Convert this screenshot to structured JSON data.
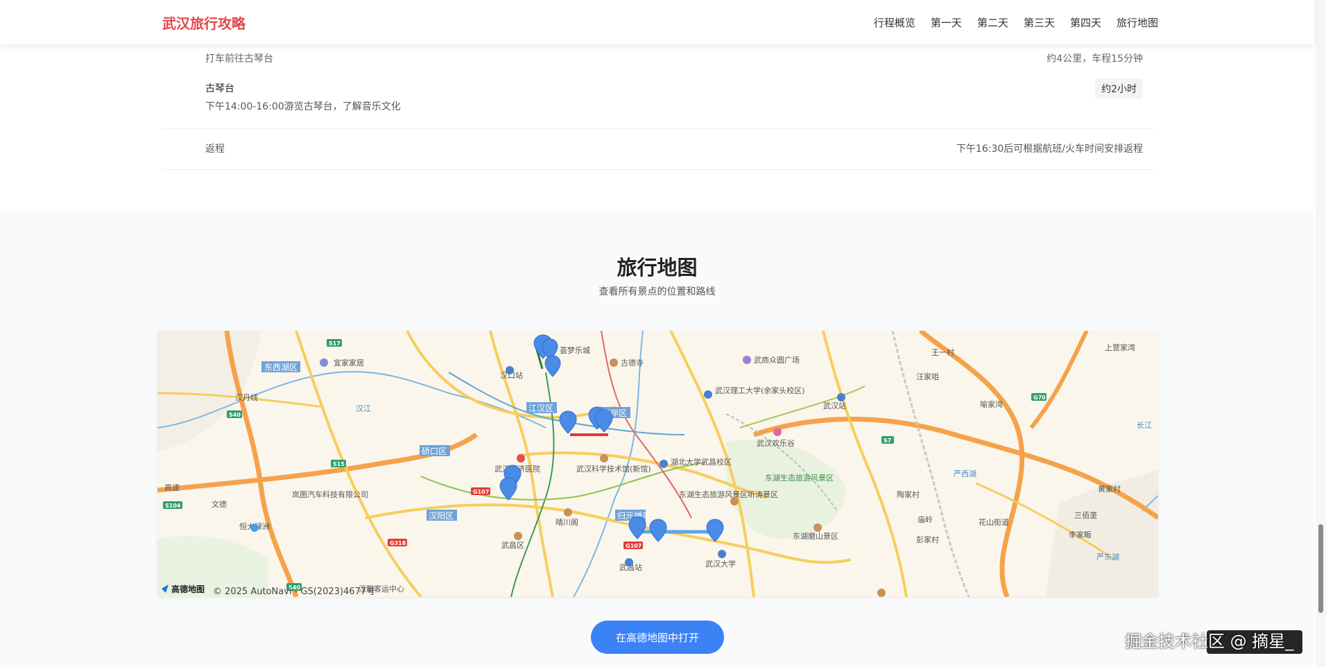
{
  "header": {
    "brand": "武汉旅行攻略",
    "nav": [
      "行程概览",
      "第一天",
      "第二天",
      "第三天",
      "第四天",
      "旅行地图"
    ]
  },
  "itinerary": {
    "transit": {
      "text": "打车前往古琴台",
      "detail": "约4公里，车程15分钟"
    },
    "spot": {
      "name": "古琴台",
      "desc": "下午14:00-16:00游览古琴台，了解音乐文化",
      "duration": "约2小时"
    },
    "return": {
      "label": "返程",
      "detail": "下午16:30后可根据航班/火车时间安排返程"
    }
  },
  "map_section": {
    "title": "旅行地图",
    "subtitle": "查看所有景点的位置和路线",
    "attribution_logo": "高德地图",
    "attribution": "© 2025 AutoNavi - GS(2023)4677号",
    "open_button": "在高德地图中打开",
    "labels": [
      "东西湖区",
      "宜家家居",
      "汉口站",
      "古德寺",
      "武商众圆广场",
      "武汉理工大学(余家头校区)",
      "武汉站",
      "江汉区",
      "江岸区",
      "汉江",
      "硚口区",
      "武汉同济医院",
      "武汉科学技术馆(新馆)",
      "湖北大学武昌校区",
      "武汉欢乐谷",
      "东湖生态旅游风景区",
      "东湖生态旅游风景区听涛景区",
      "汉阳区",
      "晴川阁",
      "武昌区",
      "东湖磨山景区",
      "归元禅寺",
      "武昌站",
      "武汉大学",
      "汉阳客运中心",
      "恒大绿洲",
      "岚图汽车科技有限公司",
      "严西湖",
      "严东湖",
      "长江",
      "上营家湾",
      "王一村",
      "汪家咀",
      "喻家湾",
      "黄家村",
      "三佰垄",
      "陶家村",
      "花山街道",
      "李家畈",
      "彭家村",
      "庙岭",
      "汉丹线",
      "文德",
      "高速",
      "荟梦乐城"
    ],
    "road_badges": [
      "S17",
      "S40",
      "S15",
      "S104",
      "G107",
      "G318",
      "G70",
      "S7",
      "G107",
      "S40"
    ]
  },
  "watermark": "掘金技术社区 @ 摘星_"
}
